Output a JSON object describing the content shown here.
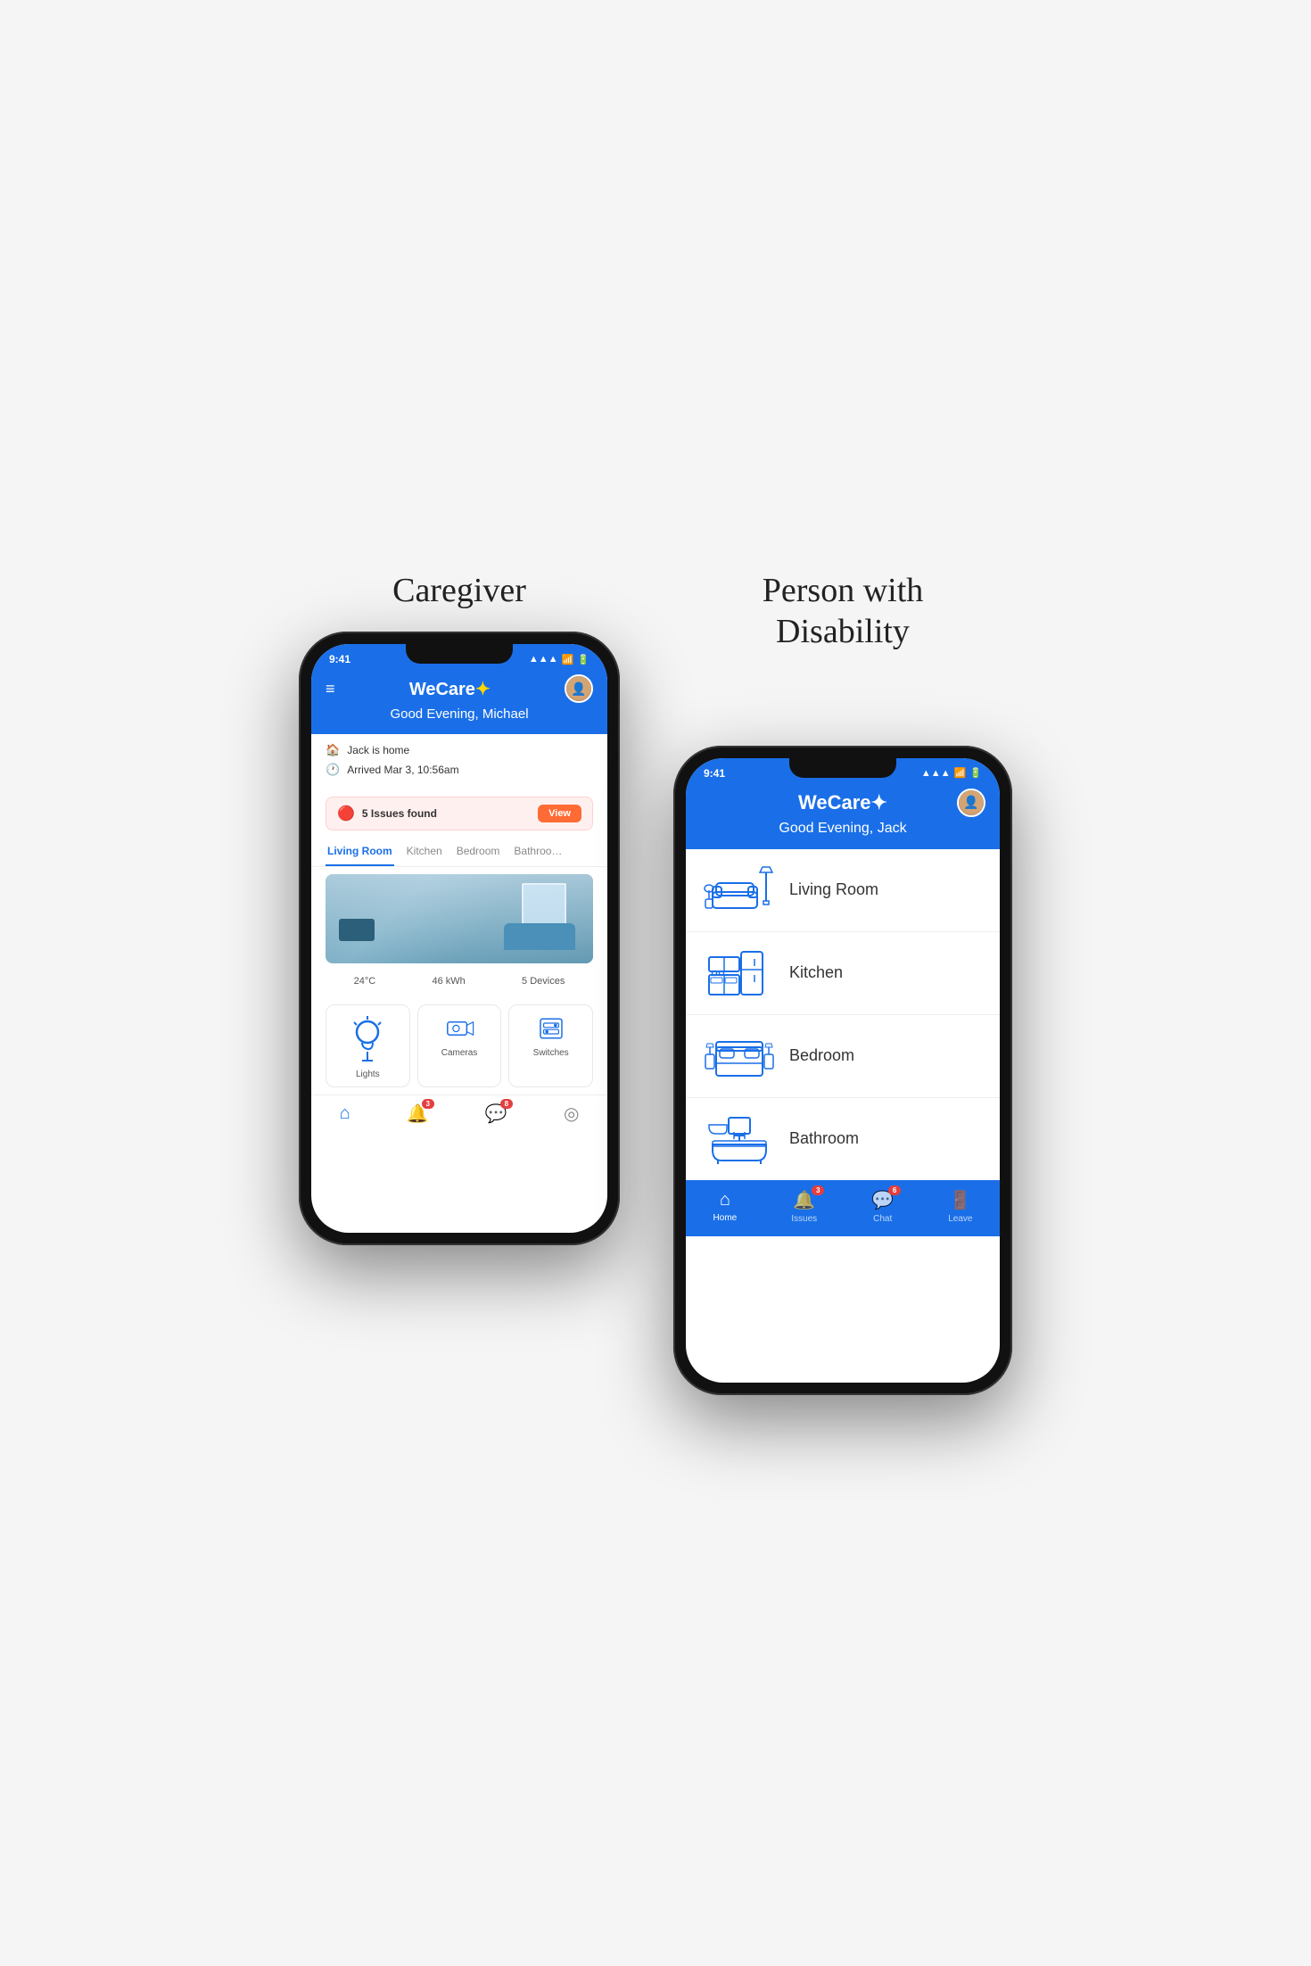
{
  "page": {
    "background": "#f5f5f5"
  },
  "left_phone": {
    "label": "Caregiver",
    "status_bar": {
      "time": "9:41",
      "signal": "▲▲▲",
      "wifi": "▾",
      "battery": "▐"
    },
    "header": {
      "logo": "WeCare",
      "logo_symbol": "✦",
      "greeting": "Good Evening, Michael"
    },
    "info": {
      "home_status": "Jack is home",
      "arrived": "Arrived Mar 3, 10:56am"
    },
    "alert": {
      "text": "5 Issues found",
      "button": "View"
    },
    "room_tabs": [
      "Living Room",
      "Kitchen",
      "Bedroom",
      "Bathroom"
    ],
    "active_tab": "Living Room",
    "stats": {
      "temp": "24°C",
      "energy": "46 kWh",
      "devices": "5 Devices"
    },
    "devices": [
      {
        "label": "Lights",
        "icon": "💡"
      },
      {
        "label": "Cameras",
        "icon": "📷"
      },
      {
        "label": "Switches",
        "icon": "🔌"
      }
    ],
    "bottom_nav": [
      {
        "label": "",
        "icon": "🏠",
        "active": true,
        "badge": null
      },
      {
        "label": "",
        "icon": "🔔",
        "active": false,
        "badge": "3"
      },
      {
        "label": "",
        "icon": "💬",
        "active": false,
        "badge": "8"
      },
      {
        "label": "",
        "icon": "🎯",
        "active": false,
        "badge": null
      }
    ]
  },
  "right_phone": {
    "label": "Person with\nDisability",
    "status_bar": {
      "time": "9:41"
    },
    "header": {
      "logo": "WeCare",
      "logo_symbol": "✦",
      "greeting": "Good Evening, Jack"
    },
    "rooms": [
      {
        "name": "Living Room",
        "id": "living"
      },
      {
        "name": "Kitchen",
        "id": "kitchen"
      },
      {
        "name": "Bedroom",
        "id": "bedroom"
      },
      {
        "name": "Bathroom",
        "id": "bathroom"
      }
    ],
    "bottom_nav": [
      {
        "label": "Home",
        "icon": "🏠",
        "active": true,
        "badge": null
      },
      {
        "label": "Issues",
        "icon": "🔔",
        "active": false,
        "badge": "3"
      },
      {
        "label": "Chat",
        "icon": "💬",
        "active": false,
        "badge": "6"
      },
      {
        "label": "Leave",
        "icon": "🚪",
        "active": false,
        "badge": null
      }
    ]
  }
}
